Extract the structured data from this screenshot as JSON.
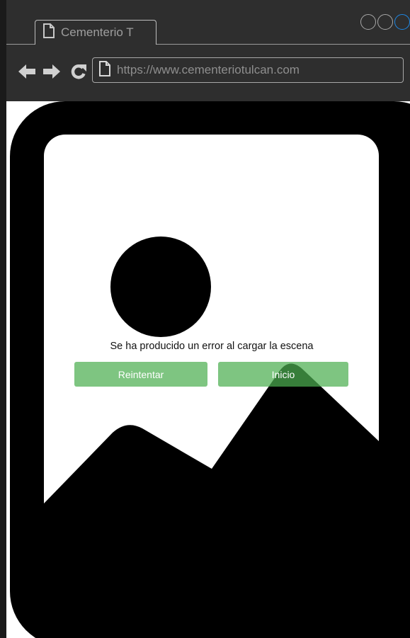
{
  "browser": {
    "tab_title": "Cementerio T",
    "url": "https://www.cementeriotulcan.com",
    "icons": {
      "back": "arrow-left-icon",
      "forward": "arrow-right-icon",
      "reload": "reload-icon",
      "page": "document-icon"
    }
  },
  "page": {
    "image_placeholder": "image-placeholder-icon",
    "error_message": "Se ha producido un error al cargar la escena",
    "retry_label": "Reintentar",
    "home_label": "Inicio"
  },
  "colors": {
    "chrome": "#2e2e2e",
    "button_green": "#4caf50",
    "window_button_accent": "#1e88e5"
  }
}
